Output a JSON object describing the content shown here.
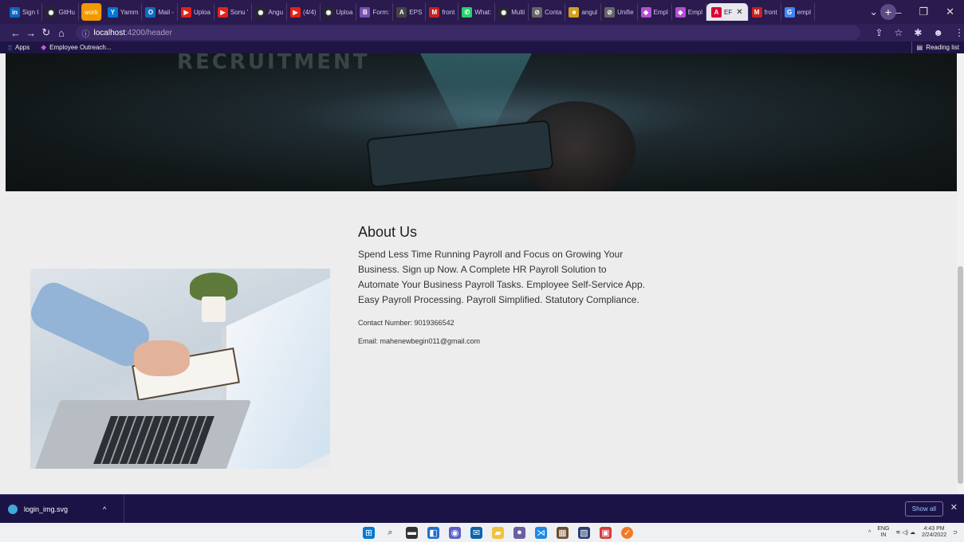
{
  "browser": {
    "tabs": [
      {
        "label": "Sign I",
        "icon": "linkedin-icon",
        "color": "#0a66c2",
        "glyph": "in"
      },
      {
        "label": "GitHu",
        "icon": "github-icon",
        "color": "#24292e",
        "glyph": "◉"
      },
      {
        "label": "work",
        "icon": "tab-group-chip",
        "color": "#f29900",
        "glyph": ""
      },
      {
        "label": "Yamm",
        "icon": "yammer-icon",
        "color": "#0078d4",
        "glyph": "Y"
      },
      {
        "label": "Mail -",
        "icon": "outlook-icon",
        "color": "#0f6cbd",
        "glyph": "O"
      },
      {
        "label": "Uploa",
        "icon": "youtube-icon",
        "color": "#e62117",
        "glyph": "▶"
      },
      {
        "label": "Sonu '",
        "icon": "youtube-icon",
        "color": "#e62117",
        "glyph": "▶"
      },
      {
        "label": "Angu",
        "icon": "github-icon",
        "color": "#24292e",
        "glyph": "◉"
      },
      {
        "label": "(4/4)",
        "icon": "youtube-icon",
        "color": "#e62117",
        "glyph": "▶"
      },
      {
        "label": "Uploa",
        "icon": "github-icon",
        "color": "#24292e",
        "glyph": "◉"
      },
      {
        "label": "Form:",
        "icon": "bootstrap-icon",
        "color": "#7952b3",
        "glyph": "B"
      },
      {
        "label": "EPS",
        "icon": "angular-icon",
        "color": "#444",
        "glyph": "A"
      },
      {
        "label": "front",
        "icon": "gmail-icon",
        "color": "#c5221f",
        "glyph": "M"
      },
      {
        "label": "What:",
        "icon": "whatsapp-icon",
        "color": "#25d366",
        "glyph": "✆"
      },
      {
        "label": "Multi",
        "icon": "github-icon",
        "color": "#24292e",
        "glyph": "◉"
      },
      {
        "label": "Conta",
        "icon": "globe-icon",
        "color": "#666",
        "glyph": "⊘"
      },
      {
        "label": "angul",
        "icon": "folder-icon",
        "color": "#d4a017",
        "glyph": "■"
      },
      {
        "label": "Unifie",
        "icon": "globe-icon",
        "color": "#666",
        "glyph": "⊘"
      },
      {
        "label": "Empl",
        "icon": "app-icon",
        "color": "#b34fd1",
        "glyph": "◆"
      },
      {
        "label": "Empl",
        "icon": "app-icon",
        "color": "#b34fd1",
        "glyph": "◆"
      },
      {
        "label": "EF",
        "icon": "angular-icon",
        "color": "#dd0031",
        "glyph": "A",
        "active": true
      },
      {
        "label": "front",
        "icon": "gmail-icon",
        "color": "#c5221f",
        "glyph": "M"
      },
      {
        "label": "empl",
        "icon": "google-icon",
        "color": "#4285f4",
        "glyph": "G"
      }
    ],
    "url_host": "localhost",
    "url_path": ":4200/header",
    "bookmarks": [
      {
        "label": "Apps",
        "icon": "apps-grid-icon"
      },
      {
        "label": "Employee Outreach...",
        "icon": "diamond-icon"
      }
    ],
    "reading_list": "Reading list"
  },
  "page": {
    "hero_text": "RECRUITMENT",
    "about": {
      "title": "About Us",
      "description": "Spend Less Time Running Payroll and Focus on Growing Your Business. Sign up Now. A Complete HR Payroll Solution to Automate Your Business Payroll Tasks. Employee Self-Service App. Easy Payroll Processing. Payroll Simplified. Statutory Compliance.",
      "contact": "Contact Number: 9019366542",
      "email": "Email: mahenewbegin011@gmail.com"
    }
  },
  "downloads": {
    "file": "login_img.svg",
    "show_all": "Show all"
  },
  "taskbar": {
    "lang_top": "ENG",
    "lang_bottom": "IN",
    "time": "4:43 PM",
    "date": "2/24/2022"
  },
  "colors": {
    "tabstrip": "#2a1a4e",
    "page_bg": "#ededed",
    "download_shelf": "#1b1346"
  }
}
